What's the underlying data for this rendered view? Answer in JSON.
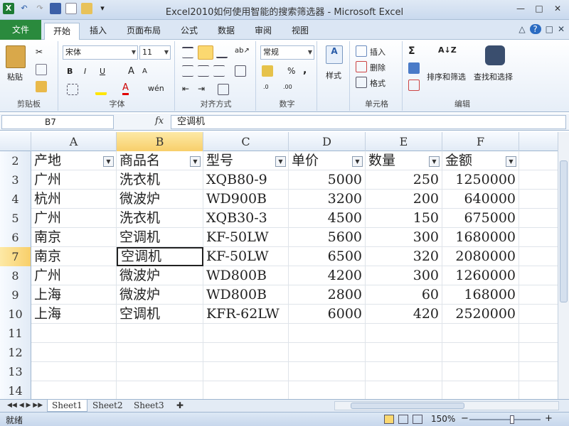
{
  "window": {
    "title": "Excel2010如何使用智能的搜索筛选器 - Microsoft Excel",
    "app_icon_letter": "X",
    "controls": [
      "—",
      "□",
      "✕"
    ]
  },
  "ribbon_tabs": [
    "文件",
    "开始",
    "插入",
    "页面布局",
    "公式",
    "数据",
    "审阅",
    "视图"
  ],
  "ribbon": {
    "clipboard": {
      "paste": "粘贴",
      "label": "剪贴板"
    },
    "font": {
      "name": "宋体",
      "size": "11",
      "bold": "B",
      "italic": "I",
      "underline": "U",
      "grow": "A",
      "shrink": "A",
      "color": "A",
      "label": "字体"
    },
    "alignment": {
      "label": "对齐方式"
    },
    "number": {
      "format": "常规",
      "percent": "%",
      "comma": ",",
      "label": "数字"
    },
    "styles": {
      "name": "样式"
    },
    "cells": {
      "insert": "插入",
      "delete": "删除",
      "format": "格式",
      "label": "单元格"
    },
    "editing": {
      "sort": "排序和筛选",
      "find": "查找和选择",
      "sigma": "Σ",
      "label": "编辑"
    }
  },
  "formula_bar": {
    "name_box": "B7",
    "fx": "fx",
    "value": "空调机"
  },
  "columns": [
    "A",
    "B",
    "C",
    "D",
    "E",
    "F"
  ],
  "selected_column": "B",
  "selected_row": 7,
  "header_row": {
    "num": "2",
    "cells": [
      "产地",
      "商品名",
      "型号",
      "单价",
      "数量",
      "金额"
    ]
  },
  "data_rows": [
    {
      "num": "3",
      "cells": [
        "广州",
        "洗衣机",
        "XQB80-9",
        "5000",
        "250",
        "1250000"
      ]
    },
    {
      "num": "4",
      "cells": [
        "杭州",
        "微波炉",
        "WD900B",
        "3200",
        "200",
        "640000"
      ]
    },
    {
      "num": "5",
      "cells": [
        "广州",
        "洗衣机",
        "XQB30-3",
        "4500",
        "150",
        "675000"
      ]
    },
    {
      "num": "6",
      "cells": [
        "南京",
        "空调机",
        "KF-50LW",
        "5600",
        "300",
        "1680000"
      ]
    },
    {
      "num": "7",
      "cells": [
        "南京",
        "空调机",
        "KF-50LW",
        "6500",
        "320",
        "2080000"
      ]
    },
    {
      "num": "8",
      "cells": [
        "广州",
        "微波炉",
        "WD800B",
        "4200",
        "300",
        "1260000"
      ]
    },
    {
      "num": "9",
      "cells": [
        "上海",
        "微波炉",
        "WD800B",
        "2800",
        "60",
        "168000"
      ]
    },
    {
      "num": "10",
      "cells": [
        "上海",
        "空调机",
        "KFR-62LW",
        "6000",
        "420",
        "2520000"
      ]
    }
  ],
  "empty_rows": [
    "11",
    "12",
    "13",
    "14"
  ],
  "sheets": [
    "Sheet1",
    "Sheet2",
    "Sheet3"
  ],
  "status": {
    "ready": "就绪",
    "zoom": "150%",
    "minus": "−",
    "plus": "+",
    "zoom_fraction": 0.6
  }
}
